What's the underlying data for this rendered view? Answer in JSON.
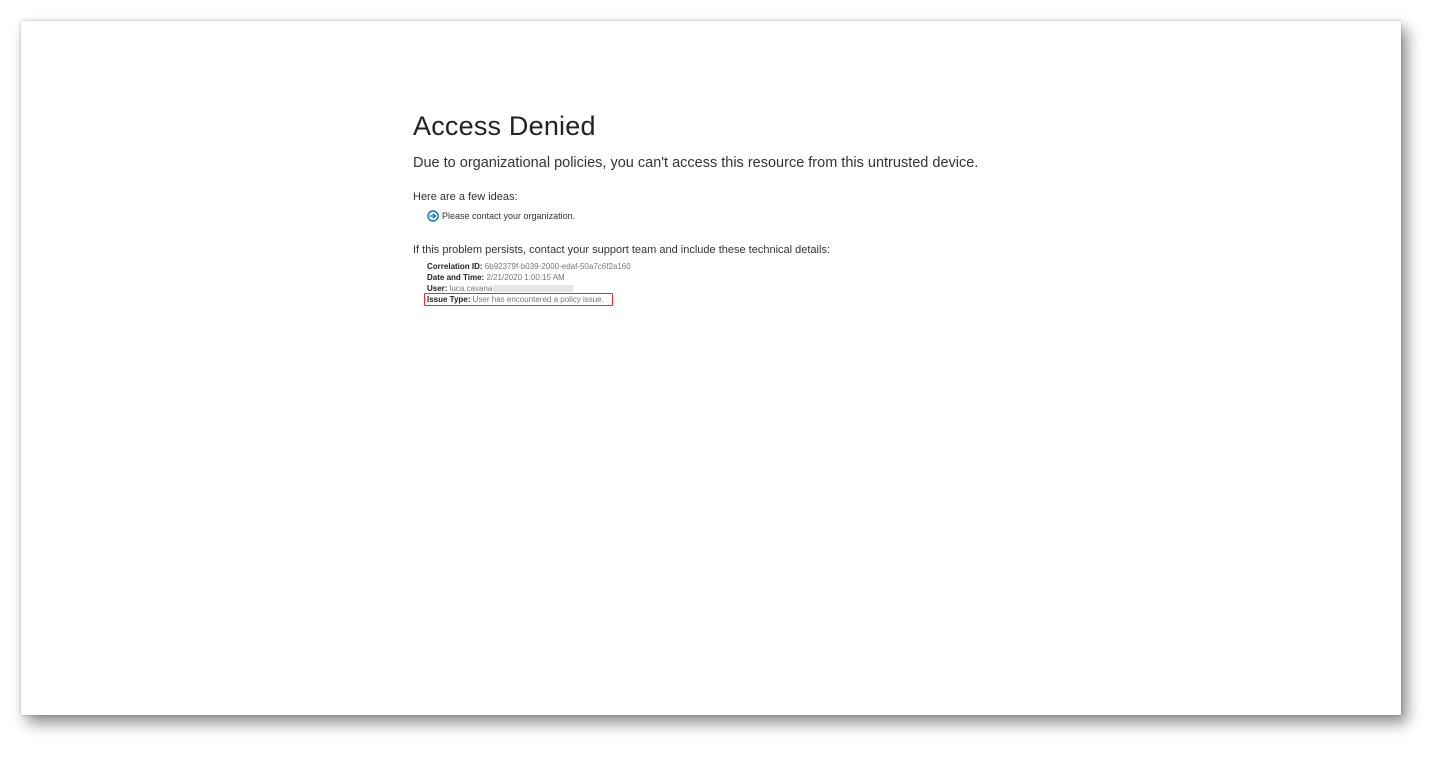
{
  "page": {
    "title": "Access Denied",
    "message": "Due to organizational policies, you can't access this resource from this untrusted device.",
    "ideas_heading": "Here are a few ideas:",
    "ideas": [
      {
        "label": "Please contact your organization.",
        "icon": "arrow-circle-right-icon"
      }
    ],
    "persist_text": "If this problem persists, contact your support team and include these technical details:"
  },
  "details": {
    "correlation_label": "Correlation ID:",
    "correlation_value": "6b92379f-b039-2000-edaf-50a7c6f2a160",
    "datetime_label": "Date and Time:",
    "datetime_value": "2/21/2020 1:00:15 AM",
    "user_label": "User:",
    "user_value": "luca.cavana",
    "issue_label": "Issue Type:",
    "issue_value": "User has encountered a policy issue."
  },
  "colors": {
    "accent": "#0072c6",
    "highlight": "#e0303a"
  }
}
